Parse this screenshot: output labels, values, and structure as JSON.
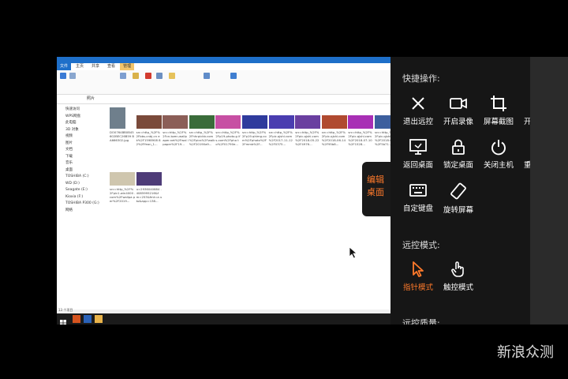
{
  "remote": {
    "ribbon_tabs": [
      "文件",
      "主页",
      "共享",
      "查看",
      "管理"
    ],
    "address": "照片",
    "nav_items": [
      "快速访问",
      "WPS网盘",
      "此电脑",
      "3D 对象",
      "视频",
      "图片",
      "文档",
      "下载",
      "音乐",
      "桌面",
      "TOSHIBA (C:)",
      "WD (D:)",
      "Seagate (E:)",
      "Kioxia (F:)",
      "TOSHIBA P300 (G:)",
      "网络"
    ],
    "files": [
      {
        "name": "DO0764BB0B45 602BEC26B59 BA666302.jpg",
        "color": "#6f7f8c"
      },
      {
        "name": "src=http_%2F% 2Fbbs-cnbj.cn ek%2F1598908 82%2Ffeon_1...",
        "color": "#7a4a3a"
      },
      {
        "name": "src=http_%2F% 2Fcn.bzen-wallp aper.net%2Fwal lpaper%2F19...",
        "color": "#8b5e57"
      },
      {
        "name": "src=http_%2F% 2Fhhrpickb.com %2Fpics%2Fwalk %2F20190a9...",
        "color": "#3a6c3a"
      },
      {
        "name": "src=http_%2F% 2Fp19.photo.g ifs.com%2Fpho to%2F01790e...",
        "color": "#c74fa3"
      },
      {
        "name": "src=http_%2F% 2Fp19.qhimg.co m%2Fphoto%2F 2Fmmb%2F...",
        "color": "#2f3b9d"
      },
      {
        "name": "src=http_%2F% 2Fpic.qjshi.com %2F2017-11-12 %2F0375...",
        "color": "#4a3db0"
      },
      {
        "name": "src=http_%2F% 2Fpic.qjshi.com %2F2018-05-22 %2F4976...",
        "color": "#6a3fa0"
      },
      {
        "name": "src=http_%2F% 2Fpic.qjshi.com %2F2018-06-14 %2F95b8...",
        "color": "#b04a30"
      },
      {
        "name": "src=http_%2F% 2Fpic.qjshi.com %2F2018-07-10 %2F1528...",
        "color": "#a82fb5"
      },
      {
        "name": "src=http_%2F% 2Fpic.qjshi.com %2F2018-08-13 %2F5b71...",
        "color": "#3d5f9e"
      },
      {
        "name": "src=http_%2F% 2Fpic1.win4000 .com%2Fwallpa per%2F2019...",
        "color": "#cfc6ae"
      },
      {
        "name": "u=2936040884 .4085995216&f m=253&fmt=a uto&app=138...",
        "color": "#4e3c78"
      }
    ],
    "status": "13 个项目"
  },
  "edit_desktop": "编辑桌面",
  "panel": {
    "shortcuts_title": "快捷操作:",
    "actions": [
      {
        "label": "退出远控",
        "icon": "close-icon"
      },
      {
        "label": "开启录像",
        "icon": "video-camera-icon"
      },
      {
        "label": "屏幕截图",
        "icon": "crop-icon"
      },
      {
        "label": "开启声音",
        "icon": "speaker-icon"
      },
      {
        "label": "返回桌面",
        "icon": "desktop-icon"
      },
      {
        "label": "锁定桌面",
        "icon": "lock-icon"
      },
      {
        "label": "关闭主机",
        "icon": "power-icon"
      },
      {
        "label": "重启主机",
        "icon": "restart-icon"
      },
      {
        "label": "自定键盘",
        "icon": "keyboard-icon"
      },
      {
        "label": "旋转屏幕",
        "icon": "rotate-icon"
      }
    ],
    "mode_title": "远控模式:",
    "modes": [
      {
        "label": "指针模式",
        "icon": "pointer-icon",
        "active": true
      },
      {
        "label": "触控模式",
        "icon": "touch-hand-icon",
        "active": false
      }
    ],
    "quality_title": "远控质量:"
  },
  "watermark": "新浪众测",
  "accent_color": "#ff7a2b"
}
